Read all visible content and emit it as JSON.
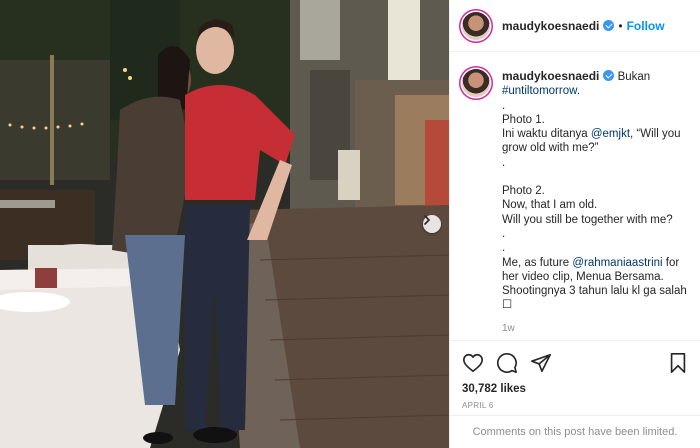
{
  "post": {
    "username": "maudykoesnaedi",
    "follow_label": "Follow",
    "separator": "•",
    "caption_lines": [
      {
        "text": "Bukan"
      },
      {
        "text": "#untiltomorrow.",
        "link": true
      },
      {
        "text": "."
      },
      {
        "text": "Photo 1."
      },
      {
        "pre": "Ini waktu ditanya ",
        "link_text": "@emjkt",
        "post": ", “Will you"
      },
      {
        "text": "grow old with me?”"
      },
      {
        "text": "."
      },
      {
        "text": ""
      },
      {
        "text": "Photo 2."
      },
      {
        "text": "Now, that I am old."
      },
      {
        "text": "Will you still be together with me?"
      },
      {
        "text": "."
      },
      {
        "text": "."
      },
      {
        "pre": "Me, as future ",
        "link_text": "@rahmaniaastrini",
        "post": " for"
      },
      {
        "text": "her video clip, Menua Bersama."
      },
      {
        "text": "Shootingnya 3 tahun lalu kl ga salah"
      },
      {
        "text": "☐"
      }
    ],
    "comment_time": "1w",
    "likes": "30,782 likes",
    "date": "APRIL 6",
    "comments_limited": "Comments on this post have been limited."
  },
  "icons": {
    "like": "heart-icon",
    "comment": "comment-icon",
    "share": "share-icon",
    "save": "bookmark-icon",
    "next": "chevron-right-icon",
    "verified": "verified-badge-icon"
  },
  "colors": {
    "link": "#00376b",
    "follow": "#0095f6",
    "verified": "#3897f0",
    "muted": "#8e8e8e",
    "border": "#efefef"
  }
}
